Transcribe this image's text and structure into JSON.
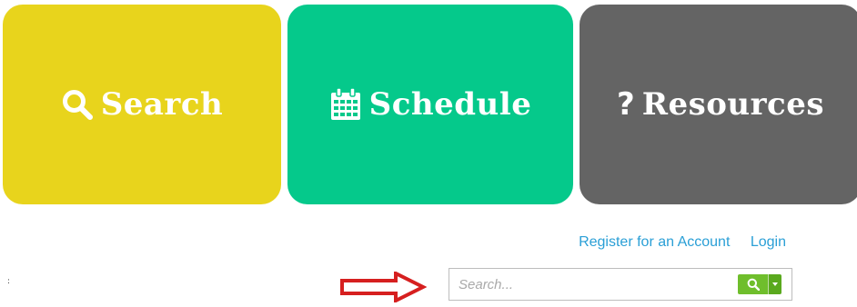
{
  "tiles": [
    {
      "label": "Search",
      "icon": "search-icon",
      "color": "#e8d41c"
    },
    {
      "label": "Schedule",
      "icon": "calendar-icon",
      "color": "#05c98b"
    },
    {
      "label": "Resources",
      "icon": "question-icon",
      "color": "#646464"
    }
  ],
  "header_links": {
    "register": "Register for an Account",
    "login": "Login",
    "color": "#2a9fd6"
  },
  "search": {
    "placeholder": "Search...",
    "button_color": "#6fbe2c",
    "button_caret_color": "#5aa91e",
    "button_icon": "search-icon",
    "caret_icon": "caret-down-icon"
  },
  "annotation": {
    "icon": "arrow-right-icon",
    "color": "#d61f1f"
  },
  "edge_mark": ":"
}
